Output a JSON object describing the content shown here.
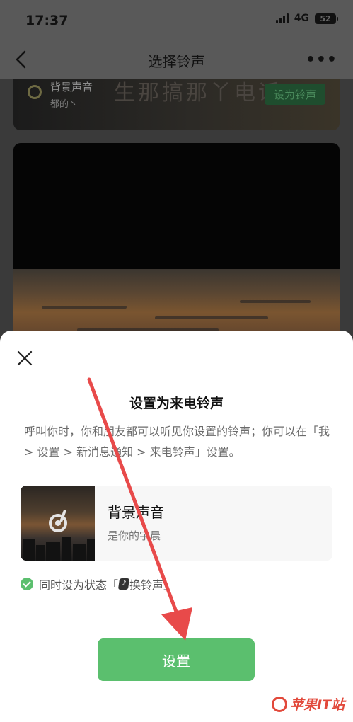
{
  "status_bar": {
    "time": "17:37",
    "network": "4G",
    "battery": "52"
  },
  "nav": {
    "title": "选择铃声",
    "more": "•••",
    "back_icon": "chevron-left-icon"
  },
  "background_items": [
    {
      "name": "背景声音",
      "subtitle": "都的丶",
      "overlay_text": "生那搞那丫电话",
      "button_label": "设为铃声"
    }
  ],
  "sheet": {
    "close_icon": "close-icon",
    "title": "设置为来电铃声",
    "description": "呼叫你时，你和朋友都可以听见你设置的铃声；你可以在「我 > 设置 > 新消息通知 > 来电铃声」设置。",
    "tone": {
      "name": "背景声音",
      "subtitle": "是你的宇晨",
      "icon": "music-disc-icon"
    },
    "status_option": {
      "checked": true,
      "text_before": "同时设为状态「",
      "badge": "♪",
      "text_after": "换铃声」"
    },
    "set_button": "设置"
  },
  "annotation": {
    "arrow_color": "#e84a4a"
  },
  "watermark": {
    "text": "苹果IT站"
  },
  "colors": {
    "accent_green": "#5bbf6e",
    "overlay_dim": "#595959"
  }
}
